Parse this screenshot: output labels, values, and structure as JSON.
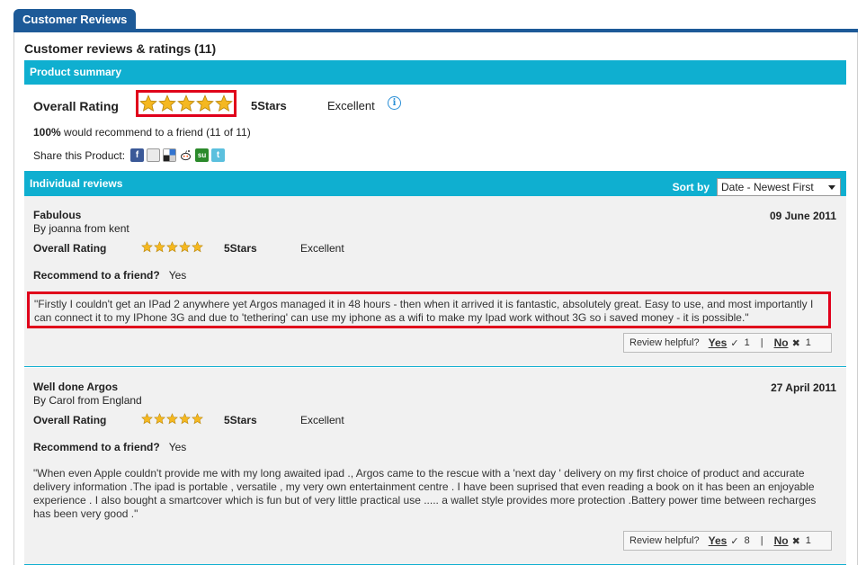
{
  "tab": {
    "label": "Customer Reviews"
  },
  "heading": "Customer reviews & ratings (11)",
  "summary": {
    "bar_label": "Product summary",
    "overall_label": "Overall Rating",
    "stars": 5,
    "stars_text": "5Stars",
    "rating_word": "Excellent",
    "info_glyph": "i",
    "recommend_pct": "100%",
    "recommend_text": " would recommend to a friend (11 of 11)",
    "share_label": "Share this Product:",
    "share_icons": [
      "facebook-icon",
      "myspace-icon",
      "delicious-icon",
      "reddit-icon",
      "stumbleupon-icon",
      "twitter-icon"
    ]
  },
  "reviews_bar": {
    "label": "Individual reviews",
    "sort_label": "Sort by",
    "sort_value": "Date - Newest First"
  },
  "reviews": [
    {
      "title": "Fabulous",
      "by": "By joanna from kent",
      "date": "09 June 2011",
      "overall_label": "Overall Rating",
      "stars": 5,
      "stars_text": "5Stars",
      "rating_word": "Excellent",
      "recommend_label": "Recommend to a friend?",
      "recommend_value": "Yes",
      "text": "\"Firstly I couldn't get an IPad 2 anywhere yet Argos managed it in 48 hours - then when it arrived it is fantastic, absolutely great. Easy to use, and most importantly I can connect it to my IPhone 3G and due to 'tethering' can use my iphone as a wifi to make my Ipad work without 3G so i saved money - it is possible.\"",
      "helpful_label": "Review helpful?",
      "yes_label": "Yes",
      "yes_count": "1",
      "no_label": "No",
      "no_count": "1"
    },
    {
      "title": "Well done Argos",
      "by": "By Carol from England",
      "date": "27 April 2011",
      "overall_label": "Overall Rating",
      "stars": 5,
      "stars_text": "5Stars",
      "rating_word": "Excellent",
      "recommend_label": "Recommend to a friend?",
      "recommend_value": "Yes",
      "text": "\"When even Apple couldn't provide me with my long awaited ipad ., Argos came to the rescue with a 'next day ' delivery on my first choice of product and accurate delivery information .The ipad is portable , versatile , my very own entertainment centre . I have been suprised that even reading a book on it has been an enjoyable experience . I also bought a smartcover which is fun but of very little practical use ..... a wallet style provides more protection .Battery power time between recharges has been very good .\"",
      "helpful_label": "Review helpful?",
      "yes_label": "Yes",
      "yes_count": "8",
      "no_label": "No",
      "no_count": "1"
    }
  ],
  "colors": {
    "brand_blue": "#1d5a98",
    "bar_cyan": "#0fafd0",
    "highlight_red": "#e0001b",
    "star": "#f5b820"
  }
}
